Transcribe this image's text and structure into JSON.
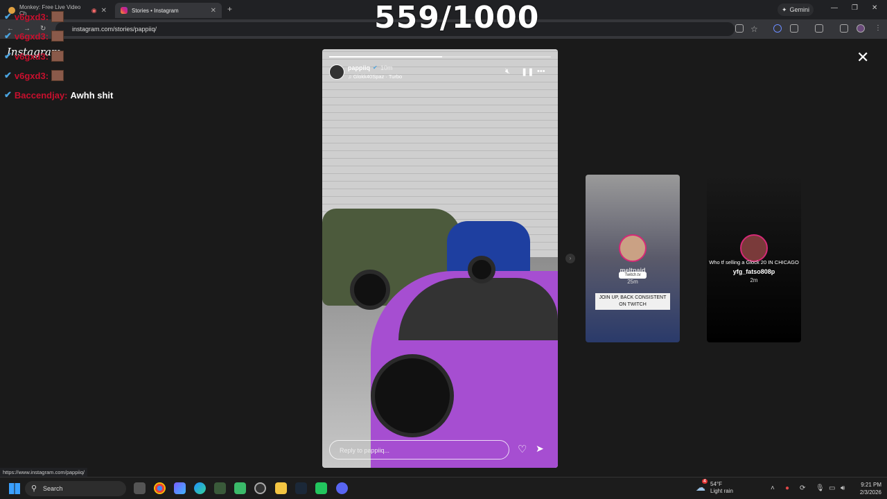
{
  "browser": {
    "tabs": [
      {
        "title": "Monkey: Free Live Video Ch",
        "active": false
      },
      {
        "title": "Stories • Instagram",
        "active": true
      }
    ],
    "new_tab": "+",
    "gemini_label": "Gemini",
    "url": "instagram.com/stories/pappiiq/",
    "status_url": "https://www.instagram.com/pappiiq/"
  },
  "overlay": {
    "counter": "559/1000",
    "chat": [
      {
        "user": "v6gxd3:",
        "message": ""
      },
      {
        "user": "v6gxd3:",
        "message": ""
      },
      {
        "user": "v6gxd3:",
        "message": ""
      },
      {
        "user": "v6gxd3:",
        "message": ""
      },
      {
        "user": "Baccendjay:",
        "message": "Awhh shit"
      }
    ]
  },
  "instagram": {
    "logo_text": "Instagram",
    "story": {
      "username": "pappiiq",
      "time": "10m",
      "song": "Glokk40Spaz · Turbo",
      "reply_placeholder": "Reply to pappiiq...",
      "progress": 0.51
    },
    "previews": [
      {
        "username": "meltpaid",
        "time": "25m",
        "sticker": "Twitch.tv",
        "caption": "JOIN UP, BACK CONSISTENT ON TWITCH"
      },
      {
        "username": "yfg_fatso808p",
        "time": "2m",
        "caption": "Who tf selling a Glock 20 IN CHICAGO"
      }
    ]
  },
  "taskbar": {
    "search_label": "Search",
    "weather_temp": "54°F",
    "weather_desc": "Light rain",
    "weather_badge": "4",
    "time": "9:21 PM",
    "date": "2/3/2026"
  }
}
